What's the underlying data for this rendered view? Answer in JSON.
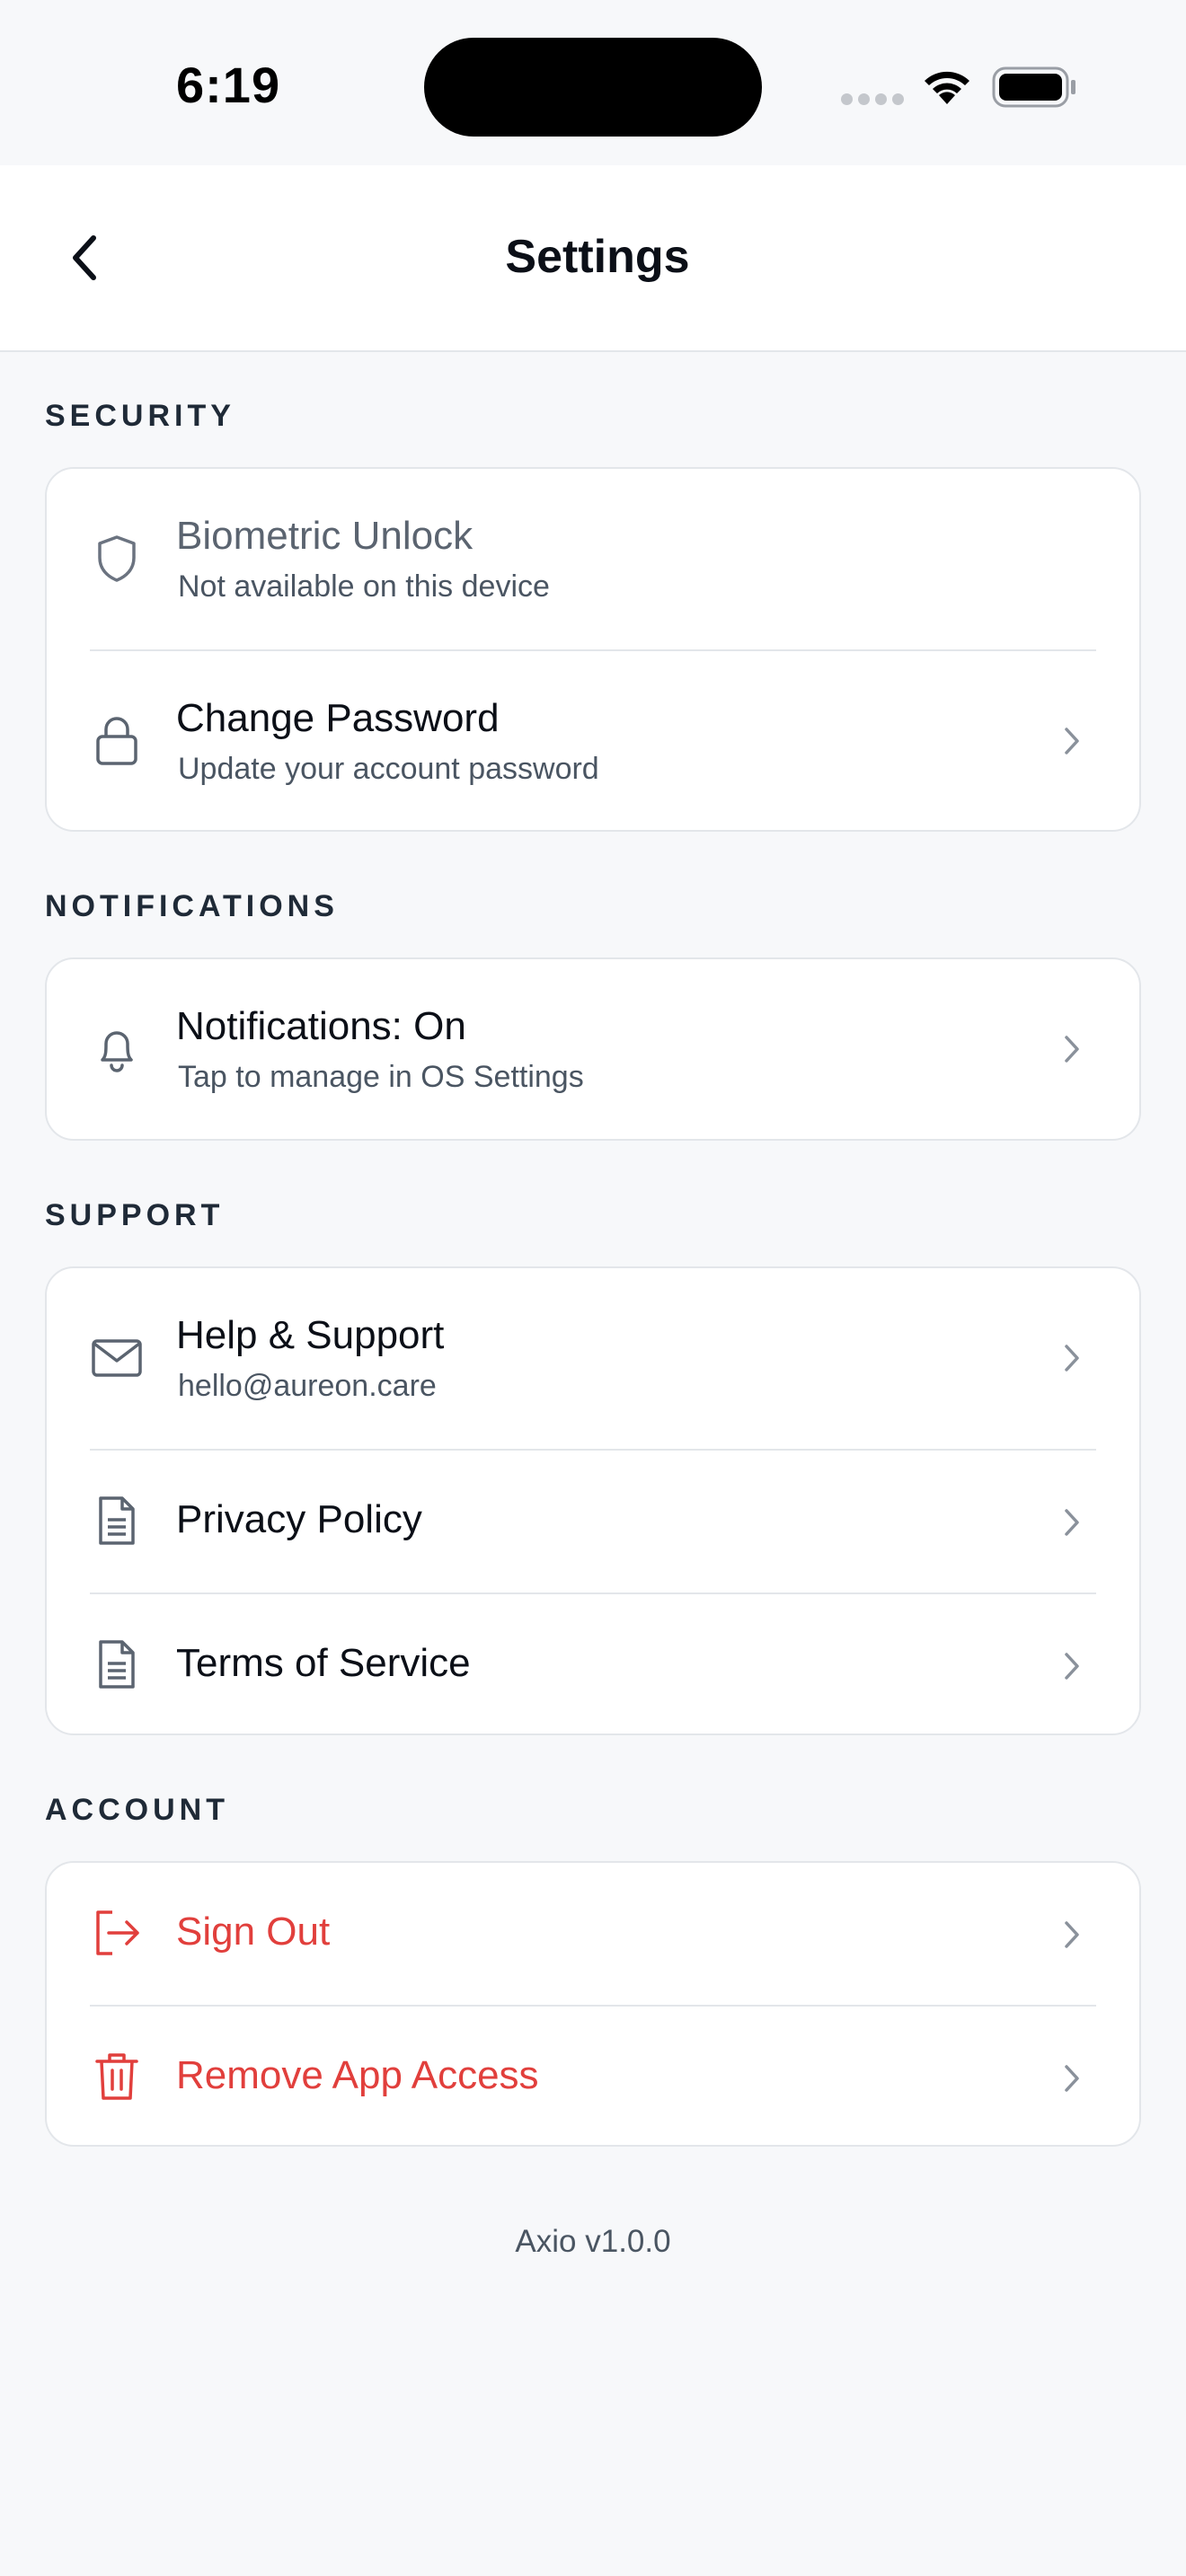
{
  "status_bar": {
    "time": "6:19"
  },
  "nav": {
    "title": "Settings"
  },
  "sections": {
    "security": {
      "header": "SECURITY",
      "biometric": {
        "title": "Biometric Unlock",
        "subtitle": "Not available on this device"
      },
      "change_password": {
        "title": "Change Password",
        "subtitle": "Update your account password"
      }
    },
    "notifications": {
      "header": "NOTIFICATIONS",
      "notifications": {
        "title": "Notifications: On",
        "subtitle": "Tap to manage in OS Settings"
      }
    },
    "support": {
      "header": "SUPPORT",
      "help": {
        "title": "Help & Support",
        "subtitle": "hello@aureon.care"
      },
      "privacy": {
        "title": "Privacy Policy"
      },
      "terms": {
        "title": "Terms of Service"
      }
    },
    "account": {
      "header": "ACCOUNT",
      "sign_out": {
        "title": "Sign Out"
      },
      "remove_access": {
        "title": "Remove App Access"
      }
    }
  },
  "footer": {
    "version": "Axio v1.0.0"
  },
  "colors": {
    "danger": "#e13f3c",
    "text": "#0b0f17",
    "muted": "#4a5562",
    "background": "#f7f8fa",
    "icon": "#5b6470"
  },
  "icons": [
    "chevron-left-icon",
    "shield-icon",
    "lock-icon",
    "bell-icon",
    "mail-icon",
    "document-icon",
    "sign-out-icon",
    "trash-icon",
    "chevron-right-icon"
  ]
}
